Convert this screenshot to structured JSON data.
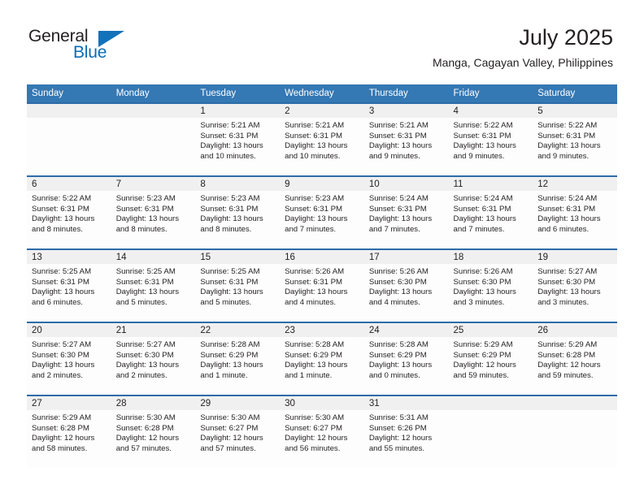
{
  "brand": {
    "name_part1": "General",
    "name_part2": "Blue",
    "color_primary": "#1472bb",
    "color_text": "#231f20"
  },
  "header": {
    "month_title": "July 2025",
    "location": "Manga, Cagayan Valley, Philippines"
  },
  "theme": {
    "header_blue": "#3478b4",
    "row_border_blue": "#2d6ca8",
    "daynum_band": "#f0f0f0",
    "cell_bg": "#fdfdfd"
  },
  "weekdays": [
    "Sunday",
    "Monday",
    "Tuesday",
    "Wednesday",
    "Thursday",
    "Friday",
    "Saturday"
  ],
  "weeks": [
    [
      {
        "empty": true
      },
      {
        "empty": true
      },
      {
        "day": "1",
        "sunrise": "Sunrise: 5:21 AM",
        "sunset": "Sunset: 6:31 PM",
        "daylight1": "Daylight: 13 hours",
        "daylight2": "and 10 minutes."
      },
      {
        "day": "2",
        "sunrise": "Sunrise: 5:21 AM",
        "sunset": "Sunset: 6:31 PM",
        "daylight1": "Daylight: 13 hours",
        "daylight2": "and 10 minutes."
      },
      {
        "day": "3",
        "sunrise": "Sunrise: 5:21 AM",
        "sunset": "Sunset: 6:31 PM",
        "daylight1": "Daylight: 13 hours",
        "daylight2": "and 9 minutes."
      },
      {
        "day": "4",
        "sunrise": "Sunrise: 5:22 AM",
        "sunset": "Sunset: 6:31 PM",
        "daylight1": "Daylight: 13 hours",
        "daylight2": "and 9 minutes."
      },
      {
        "day": "5",
        "sunrise": "Sunrise: 5:22 AM",
        "sunset": "Sunset: 6:31 PM",
        "daylight1": "Daylight: 13 hours",
        "daylight2": "and 9 minutes."
      }
    ],
    [
      {
        "day": "6",
        "sunrise": "Sunrise: 5:22 AM",
        "sunset": "Sunset: 6:31 PM",
        "daylight1": "Daylight: 13 hours",
        "daylight2": "and 8 minutes."
      },
      {
        "day": "7",
        "sunrise": "Sunrise: 5:23 AM",
        "sunset": "Sunset: 6:31 PM",
        "daylight1": "Daylight: 13 hours",
        "daylight2": "and 8 minutes."
      },
      {
        "day": "8",
        "sunrise": "Sunrise: 5:23 AM",
        "sunset": "Sunset: 6:31 PM",
        "daylight1": "Daylight: 13 hours",
        "daylight2": "and 8 minutes."
      },
      {
        "day": "9",
        "sunrise": "Sunrise: 5:23 AM",
        "sunset": "Sunset: 6:31 PM",
        "daylight1": "Daylight: 13 hours",
        "daylight2": "and 7 minutes."
      },
      {
        "day": "10",
        "sunrise": "Sunrise: 5:24 AM",
        "sunset": "Sunset: 6:31 PM",
        "daylight1": "Daylight: 13 hours",
        "daylight2": "and 7 minutes."
      },
      {
        "day": "11",
        "sunrise": "Sunrise: 5:24 AM",
        "sunset": "Sunset: 6:31 PM",
        "daylight1": "Daylight: 13 hours",
        "daylight2": "and 7 minutes."
      },
      {
        "day": "12",
        "sunrise": "Sunrise: 5:24 AM",
        "sunset": "Sunset: 6:31 PM",
        "daylight1": "Daylight: 13 hours",
        "daylight2": "and 6 minutes."
      }
    ],
    [
      {
        "day": "13",
        "sunrise": "Sunrise: 5:25 AM",
        "sunset": "Sunset: 6:31 PM",
        "daylight1": "Daylight: 13 hours",
        "daylight2": "and 6 minutes."
      },
      {
        "day": "14",
        "sunrise": "Sunrise: 5:25 AM",
        "sunset": "Sunset: 6:31 PM",
        "daylight1": "Daylight: 13 hours",
        "daylight2": "and 5 minutes."
      },
      {
        "day": "15",
        "sunrise": "Sunrise: 5:25 AM",
        "sunset": "Sunset: 6:31 PM",
        "daylight1": "Daylight: 13 hours",
        "daylight2": "and 5 minutes."
      },
      {
        "day": "16",
        "sunrise": "Sunrise: 5:26 AM",
        "sunset": "Sunset: 6:31 PM",
        "daylight1": "Daylight: 13 hours",
        "daylight2": "and 4 minutes."
      },
      {
        "day": "17",
        "sunrise": "Sunrise: 5:26 AM",
        "sunset": "Sunset: 6:30 PM",
        "daylight1": "Daylight: 13 hours",
        "daylight2": "and 4 minutes."
      },
      {
        "day": "18",
        "sunrise": "Sunrise: 5:26 AM",
        "sunset": "Sunset: 6:30 PM",
        "daylight1": "Daylight: 13 hours",
        "daylight2": "and 3 minutes."
      },
      {
        "day": "19",
        "sunrise": "Sunrise: 5:27 AM",
        "sunset": "Sunset: 6:30 PM",
        "daylight1": "Daylight: 13 hours",
        "daylight2": "and 3 minutes."
      }
    ],
    [
      {
        "day": "20",
        "sunrise": "Sunrise: 5:27 AM",
        "sunset": "Sunset: 6:30 PM",
        "daylight1": "Daylight: 13 hours",
        "daylight2": "and 2 minutes."
      },
      {
        "day": "21",
        "sunrise": "Sunrise: 5:27 AM",
        "sunset": "Sunset: 6:30 PM",
        "daylight1": "Daylight: 13 hours",
        "daylight2": "and 2 minutes."
      },
      {
        "day": "22",
        "sunrise": "Sunrise: 5:28 AM",
        "sunset": "Sunset: 6:29 PM",
        "daylight1": "Daylight: 13 hours",
        "daylight2": "and 1 minute."
      },
      {
        "day": "23",
        "sunrise": "Sunrise: 5:28 AM",
        "sunset": "Sunset: 6:29 PM",
        "daylight1": "Daylight: 13 hours",
        "daylight2": "and 1 minute."
      },
      {
        "day": "24",
        "sunrise": "Sunrise: 5:28 AM",
        "sunset": "Sunset: 6:29 PM",
        "daylight1": "Daylight: 13 hours",
        "daylight2": "and 0 minutes."
      },
      {
        "day": "25",
        "sunrise": "Sunrise: 5:29 AM",
        "sunset": "Sunset: 6:29 PM",
        "daylight1": "Daylight: 12 hours",
        "daylight2": "and 59 minutes."
      },
      {
        "day": "26",
        "sunrise": "Sunrise: 5:29 AM",
        "sunset": "Sunset: 6:28 PM",
        "daylight1": "Daylight: 12 hours",
        "daylight2": "and 59 minutes."
      }
    ],
    [
      {
        "day": "27",
        "sunrise": "Sunrise: 5:29 AM",
        "sunset": "Sunset: 6:28 PM",
        "daylight1": "Daylight: 12 hours",
        "daylight2": "and 58 minutes."
      },
      {
        "day": "28",
        "sunrise": "Sunrise: 5:30 AM",
        "sunset": "Sunset: 6:28 PM",
        "daylight1": "Daylight: 12 hours",
        "daylight2": "and 57 minutes."
      },
      {
        "day": "29",
        "sunrise": "Sunrise: 5:30 AM",
        "sunset": "Sunset: 6:27 PM",
        "daylight1": "Daylight: 12 hours",
        "daylight2": "and 57 minutes."
      },
      {
        "day": "30",
        "sunrise": "Sunrise: 5:30 AM",
        "sunset": "Sunset: 6:27 PM",
        "daylight1": "Daylight: 12 hours",
        "daylight2": "and 56 minutes."
      },
      {
        "day": "31",
        "sunrise": "Sunrise: 5:31 AM",
        "sunset": "Sunset: 6:26 PM",
        "daylight1": "Daylight: 12 hours",
        "daylight2": "and 55 minutes."
      },
      {
        "empty": true
      },
      {
        "empty": true
      }
    ]
  ]
}
